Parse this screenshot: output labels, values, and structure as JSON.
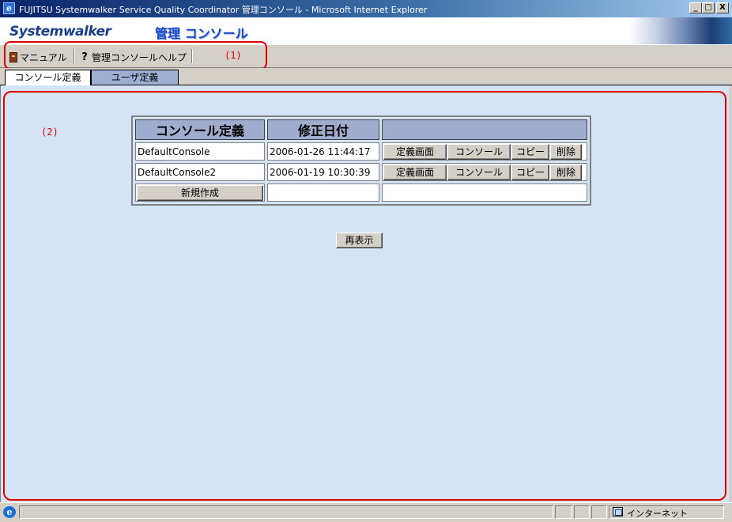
{
  "window": {
    "title": "FUJITSU Systemwalker Service Quality Coordinator 管理コンソール - Microsoft Internet Explorer",
    "minimize": "_",
    "maximize": "□",
    "close": "X"
  },
  "banner": {
    "logo": "Systemwalker",
    "title": "管理 コンソール"
  },
  "toolbar": {
    "manual_label": "マニュアル",
    "help_label": "管理コンソールヘルプ",
    "annotation": "(1)"
  },
  "tabs": [
    {
      "label": "コンソール定義",
      "active": true
    },
    {
      "label": "ユーザ定義",
      "active": false
    }
  ],
  "content": {
    "annotation": "(2)",
    "table": {
      "headers": [
        "コンソール定義",
        "修正日付",
        ""
      ],
      "rows": [
        {
          "name": "DefaultConsole",
          "date": "2006-01-26 11:44:17"
        },
        {
          "name": "DefaultConsole2",
          "date": "2006-01-19 10:30:39"
        }
      ],
      "row_buttons": {
        "definition": "定義画面",
        "console": "コンソール",
        "copy": "コピー",
        "delete": "削除"
      },
      "new_button": "新規作成"
    },
    "refresh_button": "再表示"
  },
  "statusbar": {
    "zone": "インターネット"
  },
  "colors": {
    "content_bg": "#d5e3f7",
    "header_bg": "#a0acce",
    "annotation_red": "#e00000",
    "title_bar": "#0a246a"
  }
}
